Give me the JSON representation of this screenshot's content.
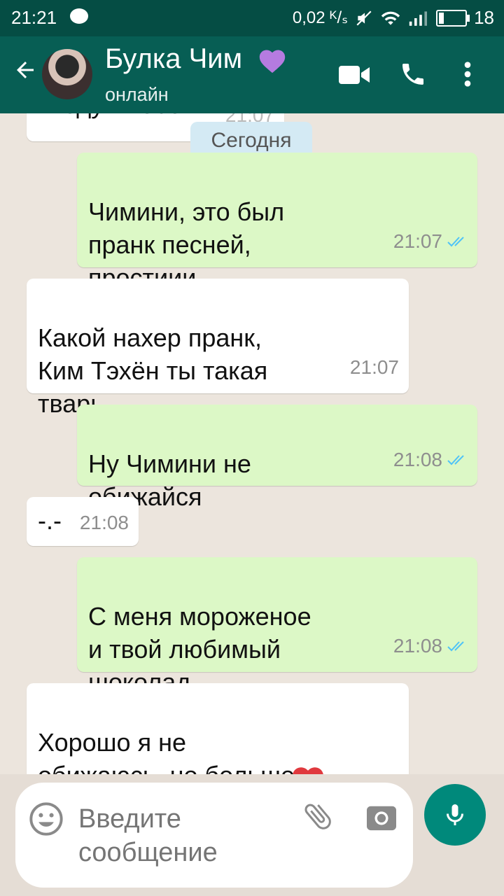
{
  "statusbar": {
    "time": "21:21",
    "net_speed": "0,02 ᴷ/ₛ",
    "battery": "18",
    "battery_level": 0.18
  },
  "header": {
    "title": "Булка Чим",
    "status": "онлайн"
  },
  "chat": {
    "day_separator": "Сегодня",
    "messages": [
      {
        "direction": "incoming",
        "text": "Я еду к тебе!",
        "time": "21:07"
      },
      {
        "direction": "outgoing",
        "text": "Чимини, это был\nпранк песней,\nпростиии",
        "time": "21:07"
      },
      {
        "direction": "incoming",
        "text": "Какой нахер пранк,\nКим Тэхён ты такая\nтварь -.-",
        "time": "21:07"
      },
      {
        "direction": "outgoing",
        "text": "Ну Чимини не\nобижайся",
        "time": "21:08"
      },
      {
        "direction": "incoming",
        "text": "-.-",
        "time": "21:08"
      },
      {
        "direction": "outgoing",
        "text": "С меня мороженое\nи твой любимый\nшоколад",
        "time": "21:08"
      },
      {
        "direction": "incoming",
        "text": "Хорошо я не\nобижаюсь, но больше",
        "time": ""
      }
    ]
  },
  "input": {
    "placeholder": "Введите сообщение"
  },
  "colors": {
    "header": "#075e54",
    "statusbar": "#054d44",
    "outgoing_bubble": "#dcf8c6",
    "incoming_bubble": "#ffffff",
    "mic_button": "#00897b",
    "read_check": "#4fc3f7"
  }
}
